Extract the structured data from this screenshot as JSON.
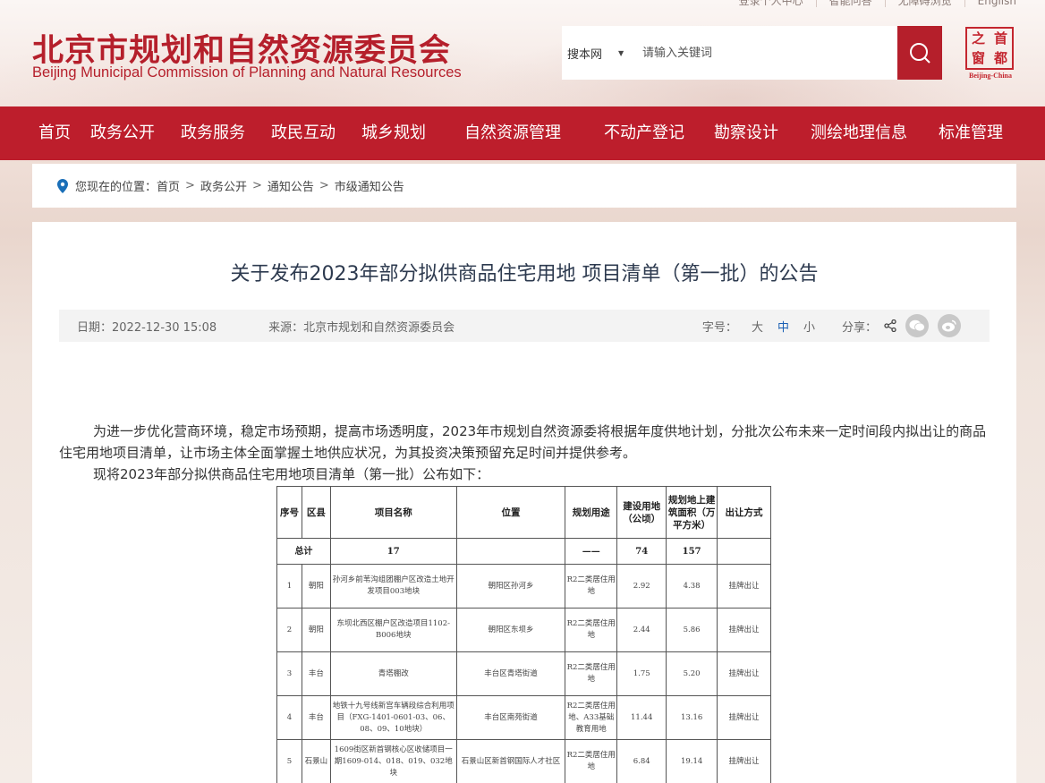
{
  "header": {
    "top_links": [
      "登录个人中心",
      "智能问答",
      "无障碍浏览",
      "English"
    ],
    "title_cn": "北京市规划和自然资源委员会",
    "title_en": "Beijing Municipal Commission of Planning and Natural Resources",
    "search": {
      "scope": "搜本网",
      "placeholder": "请输入关键词"
    },
    "seal": {
      "chars": [
        "之",
        "首",
        "窗",
        "都"
      ],
      "caption": "Beijing-China"
    }
  },
  "nav": {
    "items": [
      "首页",
      "政务公开",
      "政务服务",
      "政民互动",
      "城乡规划",
      "自然资源管理",
      "不动产登记",
      "勘察设计",
      "测绘地理信息",
      "标准管理"
    ]
  },
  "breadcrumb": {
    "prefix": "您现在的位置：",
    "items": [
      "首页",
      "政务公开",
      "通知公告",
      "市级通知公告"
    ],
    "separator": ">"
  },
  "article": {
    "title": "关于发布2023年部分拟供商品住宅用地 项目清单（第一批）的公告",
    "date": "日期：2022-12-30 15:08",
    "source": "来源：北京市规划和自然资源委员会",
    "font_size_label": "字号：",
    "font_sizes": [
      "大",
      "中",
      "小"
    ],
    "share_label": "分享：",
    "paragraphs": [
      "为进一步优化营商环境，稳定市场预期，提高市场透明度，2023年市规划自然资源委将根据年度供地计划，分批次公布未来一定时间段内拟出让的商品住宅用地项目清单，让市场主体全面掌握土地供应状况，为其投资决策预留充足时间并提供参考。",
      "现将2023年部分拟供商品住宅用地项目清单（第一批）公布如下："
    ]
  },
  "table": {
    "headers": [
      "序号",
      "区县",
      "项目名称",
      "位置",
      "规划用途",
      "建设用地（公顷）",
      "规划地上建筑面积（万平方米）",
      "出让方式"
    ],
    "total": {
      "label": "总计",
      "count": "17",
      "use": "——",
      "area": "74",
      "floor": "157",
      "blank": ""
    },
    "rows": [
      [
        "1",
        "朝阳",
        "孙河乡前苇沟组团棚户区改造土地开发项目003地块",
        "朝阳区孙河乡",
        "R2二类居住用地",
        "2.92",
        "4.38",
        "挂牌出让"
      ],
      [
        "2",
        "朝阳",
        "东坝北西区棚户区改造项目1102-B006地块",
        "朝阳区东坝乡",
        "R2二类居住用地",
        "2.44",
        "5.86",
        "挂牌出让"
      ],
      [
        "3",
        "丰台",
        "青塔棚改",
        "丰台区青塔街道",
        "R2二类居住用地",
        "1.75",
        "5.20",
        "挂牌出让"
      ],
      [
        "4",
        "丰台",
        "地铁十九号线新宫车辆段综合利用项目（FXG-1401-0601-03、06、08、09、10地块）",
        "丰台区南苑街道",
        "R2二类居住用地、A33基础教育用地",
        "11.44",
        "13.16",
        "挂牌出让"
      ],
      [
        "5",
        "石景山",
        "1609街区新首钢核心区收储项目一期1609-014、018、019、032地块",
        "石景山区新首钢国际人才社区",
        "R2二类居住用地",
        "6.84",
        "19.14",
        "挂牌出让"
      ]
    ]
  },
  "colors": {
    "brand_red": "#bd1e2c",
    "active_blue": "#1a5fb4"
  },
  "icons": [
    "search-icon",
    "location-pin-icon",
    "share-icon",
    "wechat-icon",
    "weibo-icon"
  ]
}
